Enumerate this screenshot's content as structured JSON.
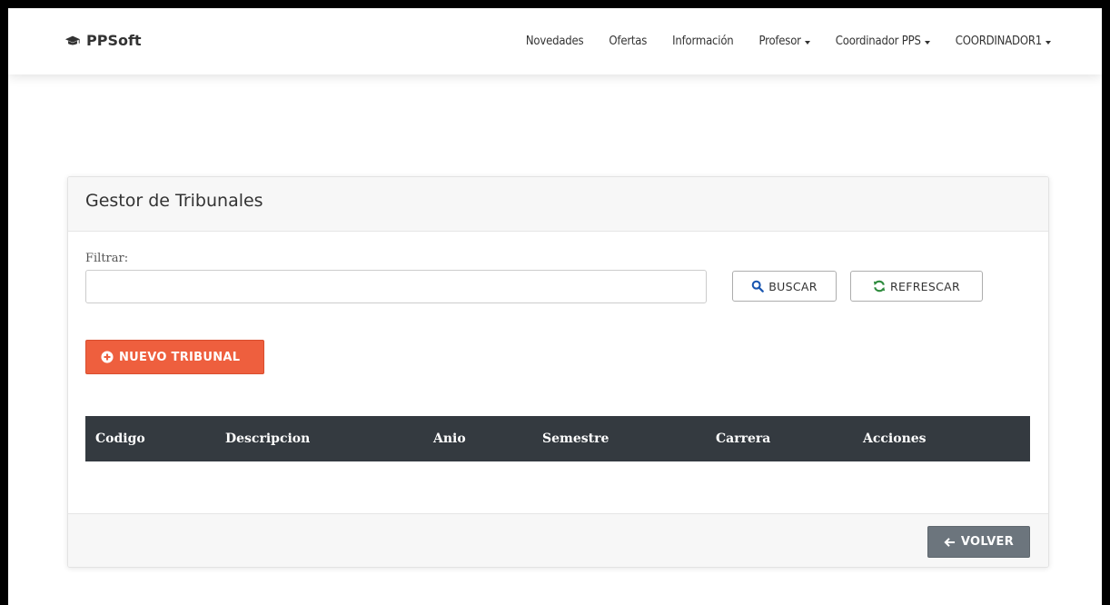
{
  "navbar": {
    "brand": "PPSoft",
    "brand_icon": "graduation-cap-icon",
    "items": [
      {
        "label": "Novedades",
        "dropdown": false
      },
      {
        "label": "Ofertas",
        "dropdown": false
      },
      {
        "label": "Información",
        "dropdown": false
      },
      {
        "label": "Profesor",
        "dropdown": true
      },
      {
        "label": "Coordinador PPS",
        "dropdown": true
      },
      {
        "label": "COORDINADOR1",
        "dropdown": true
      }
    ]
  },
  "panel": {
    "title": "Gestor de Tribunales",
    "filter": {
      "label": "Filtrar:",
      "value": "",
      "placeholder": ""
    },
    "buttons": {
      "search": {
        "label": "BUSCAR",
        "icon": "search-icon"
      },
      "refresh": {
        "label": "REFRESCAR",
        "icon": "refresh-icon"
      },
      "new": {
        "label": "NUEVO TRIBUNAL",
        "icon": "plus-circle-icon"
      },
      "back": {
        "label": "VOLVER",
        "icon": "arrow-left-icon"
      }
    },
    "table": {
      "columns": [
        "Codigo",
        "Descripcion",
        "Anio",
        "Semestre",
        "Carrera",
        "Acciones"
      ],
      "rows": []
    }
  },
  "colors": {
    "primary_button": "#ee5f3e",
    "table_header": "#343a40",
    "back_button": "#6c757d",
    "search_icon": "#1a56b0",
    "refresh_icon": "#2e8b3d"
  }
}
